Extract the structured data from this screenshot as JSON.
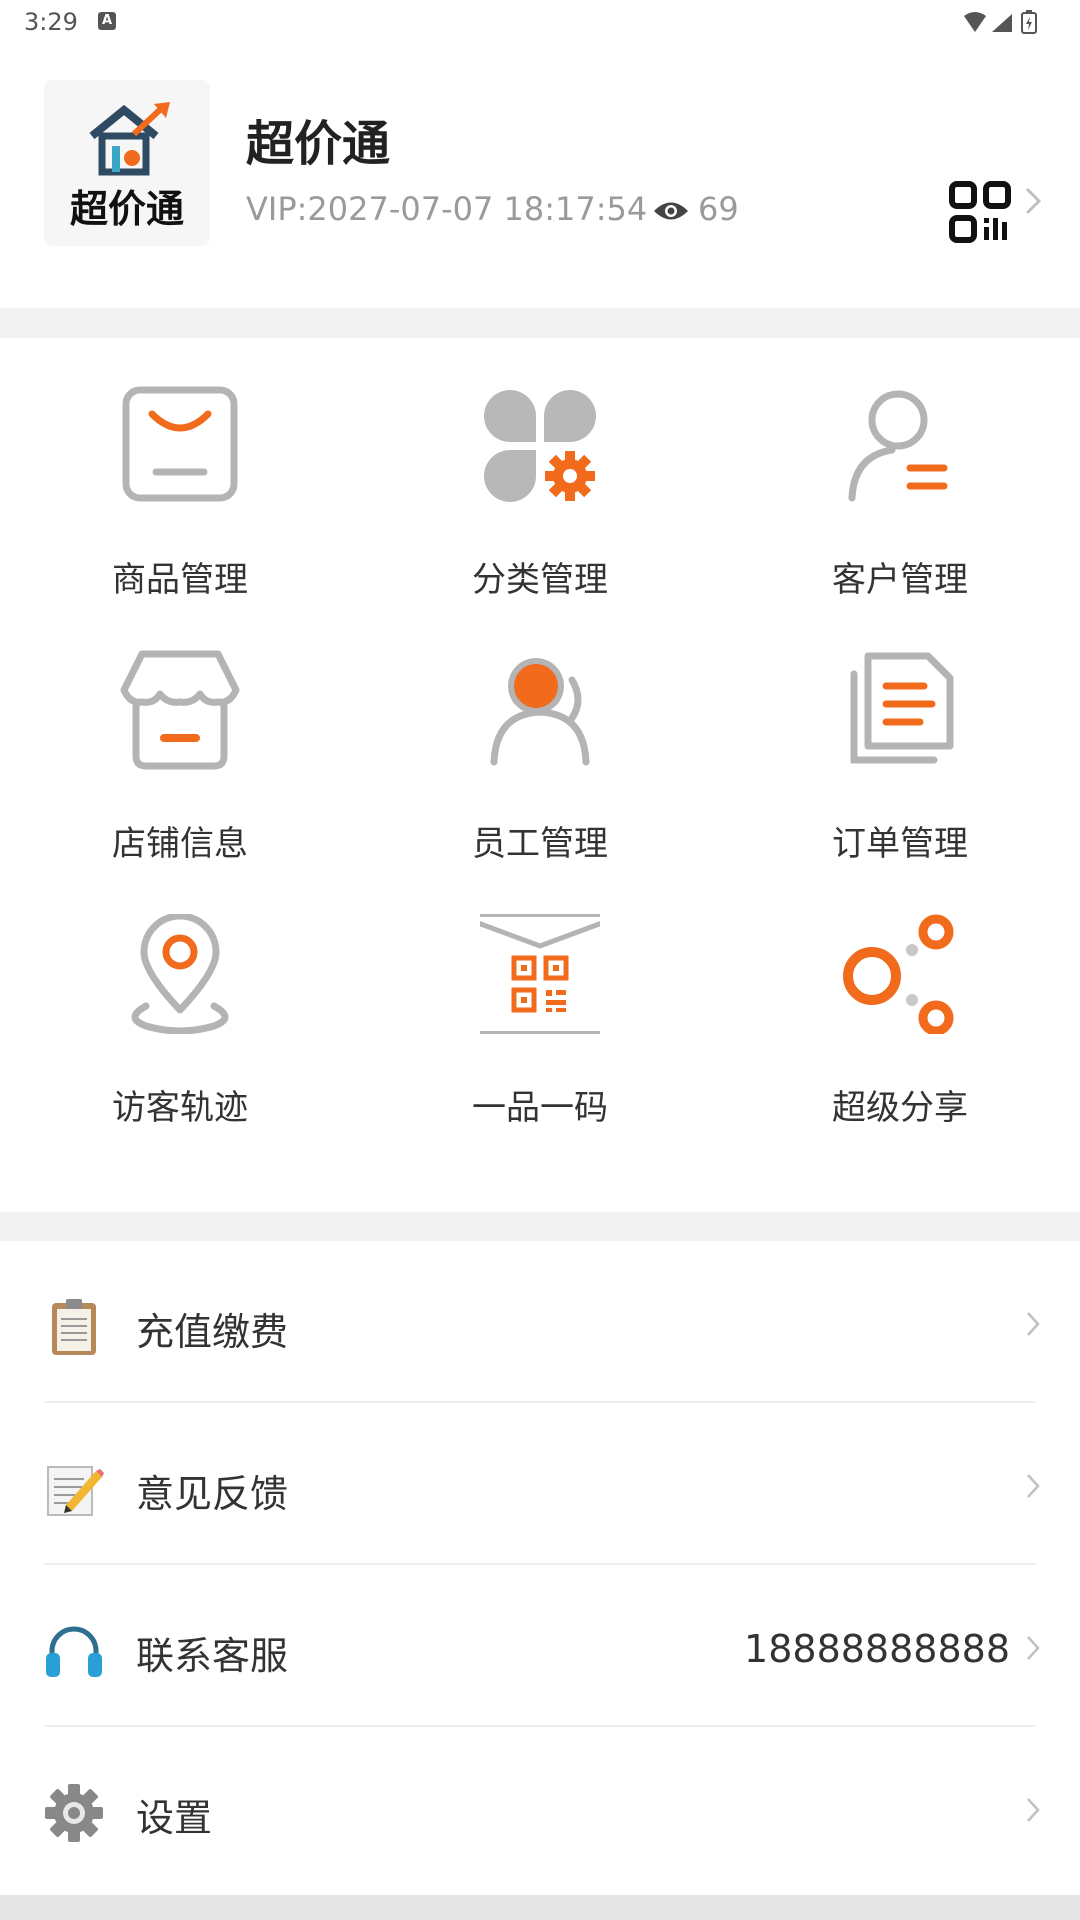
{
  "status_bar": {
    "time": "3:29",
    "notif_letter": "A"
  },
  "profile": {
    "logo_text": "超价通",
    "app_name": "超价通",
    "vip_text": "VIP:2027-07-07 18:17:54",
    "view_count": "69",
    "icons": {
      "views": "eye-icon",
      "qr": "qr-code-icon",
      "chevron": "chevron-right-icon"
    }
  },
  "grid": {
    "items": [
      {
        "label": "商品管理",
        "icon": "product-box-icon"
      },
      {
        "label": "分类管理",
        "icon": "category-gear-icon"
      },
      {
        "label": "客户管理",
        "icon": "customer-icon"
      },
      {
        "label": "店铺信息",
        "icon": "store-icon"
      },
      {
        "label": "员工管理",
        "icon": "staff-icon"
      },
      {
        "label": "订单管理",
        "icon": "order-document-icon"
      },
      {
        "label": "访客轨迹",
        "icon": "location-pin-icon"
      },
      {
        "label": "一品一码",
        "icon": "qr-envelope-icon"
      },
      {
        "label": "超级分享",
        "icon": "share-icon"
      }
    ]
  },
  "menu": {
    "items": [
      {
        "label": "充值缴费",
        "icon": "clipboard-icon",
        "value": ""
      },
      {
        "label": "意见反馈",
        "icon": "memo-pencil-icon",
        "value": ""
      },
      {
        "label": "联系客服",
        "icon": "headphones-icon",
        "value": "18888888888"
      },
      {
        "label": "设置",
        "icon": "gear-icon",
        "value": ""
      }
    ]
  },
  "colors": {
    "accent": "#f26a1b",
    "icon_gray": "#b4b4b4",
    "text": "#333333",
    "muted": "#9a9a9a"
  }
}
